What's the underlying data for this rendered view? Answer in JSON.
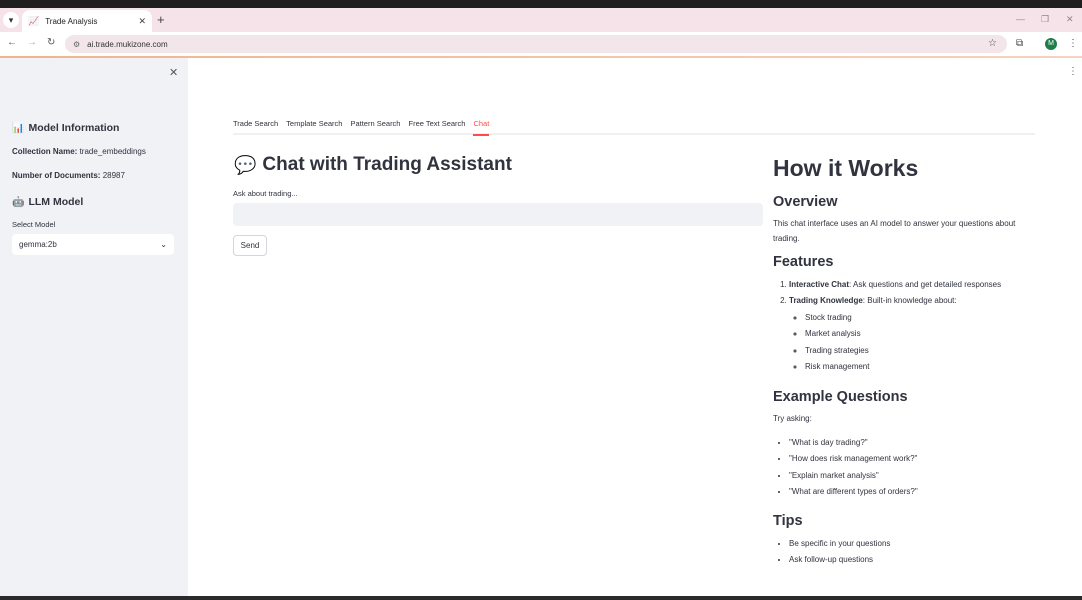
{
  "browser": {
    "tab_title": "Trade Analysis",
    "url": "ai.trade.mukizone.com",
    "profile_initial": "M"
  },
  "sidebar": {
    "model_info_title": "Model Information",
    "collection_label": "Collection Name:",
    "collection_value": "trade_embeddings",
    "documents_label": "Number of Documents:",
    "documents_value": "28987",
    "llm_title": "LLM Model",
    "select_label": "Select Model",
    "select_value": "gemma:2b"
  },
  "tabs": [
    {
      "label": "Trade Search"
    },
    {
      "label": "Template Search"
    },
    {
      "label": "Pattern Search"
    },
    {
      "label": "Free Text Search"
    },
    {
      "label": "Chat"
    }
  ],
  "chat": {
    "title": "Chat with Trading Assistant",
    "input_label": "Ask about trading...",
    "input_value": "",
    "send_label": "Send"
  },
  "how_it_works": {
    "title": "How it Works",
    "overview_heading": "Overview",
    "overview_text": "This chat interface uses an AI model to answer your questions about trading.",
    "features_heading": "Features",
    "features": [
      {
        "title": "Interactive Chat",
        "desc": ": Ask questions and get detailed responses"
      },
      {
        "title": "Trading Knowledge",
        "desc": ": Built-in knowledge about:"
      }
    ],
    "knowledge_items": [
      "Stock trading",
      "Market analysis",
      "Trading strategies",
      "Risk management"
    ],
    "examples_heading": "Example Questions",
    "examples_intro": "Try asking:",
    "examples": [
      "\"What is day trading?\"",
      "\"How does risk management work?\"",
      "\"Explain market analysis\"",
      "\"What are different types of orders?\""
    ],
    "tips_heading": "Tips",
    "tips": [
      "Be specific in your questions",
      "Ask follow-up questions"
    ]
  },
  "colors": {
    "accent": "#ff4b4b",
    "sidebar_bg": "#f0f2f6",
    "text": "#31333f"
  }
}
